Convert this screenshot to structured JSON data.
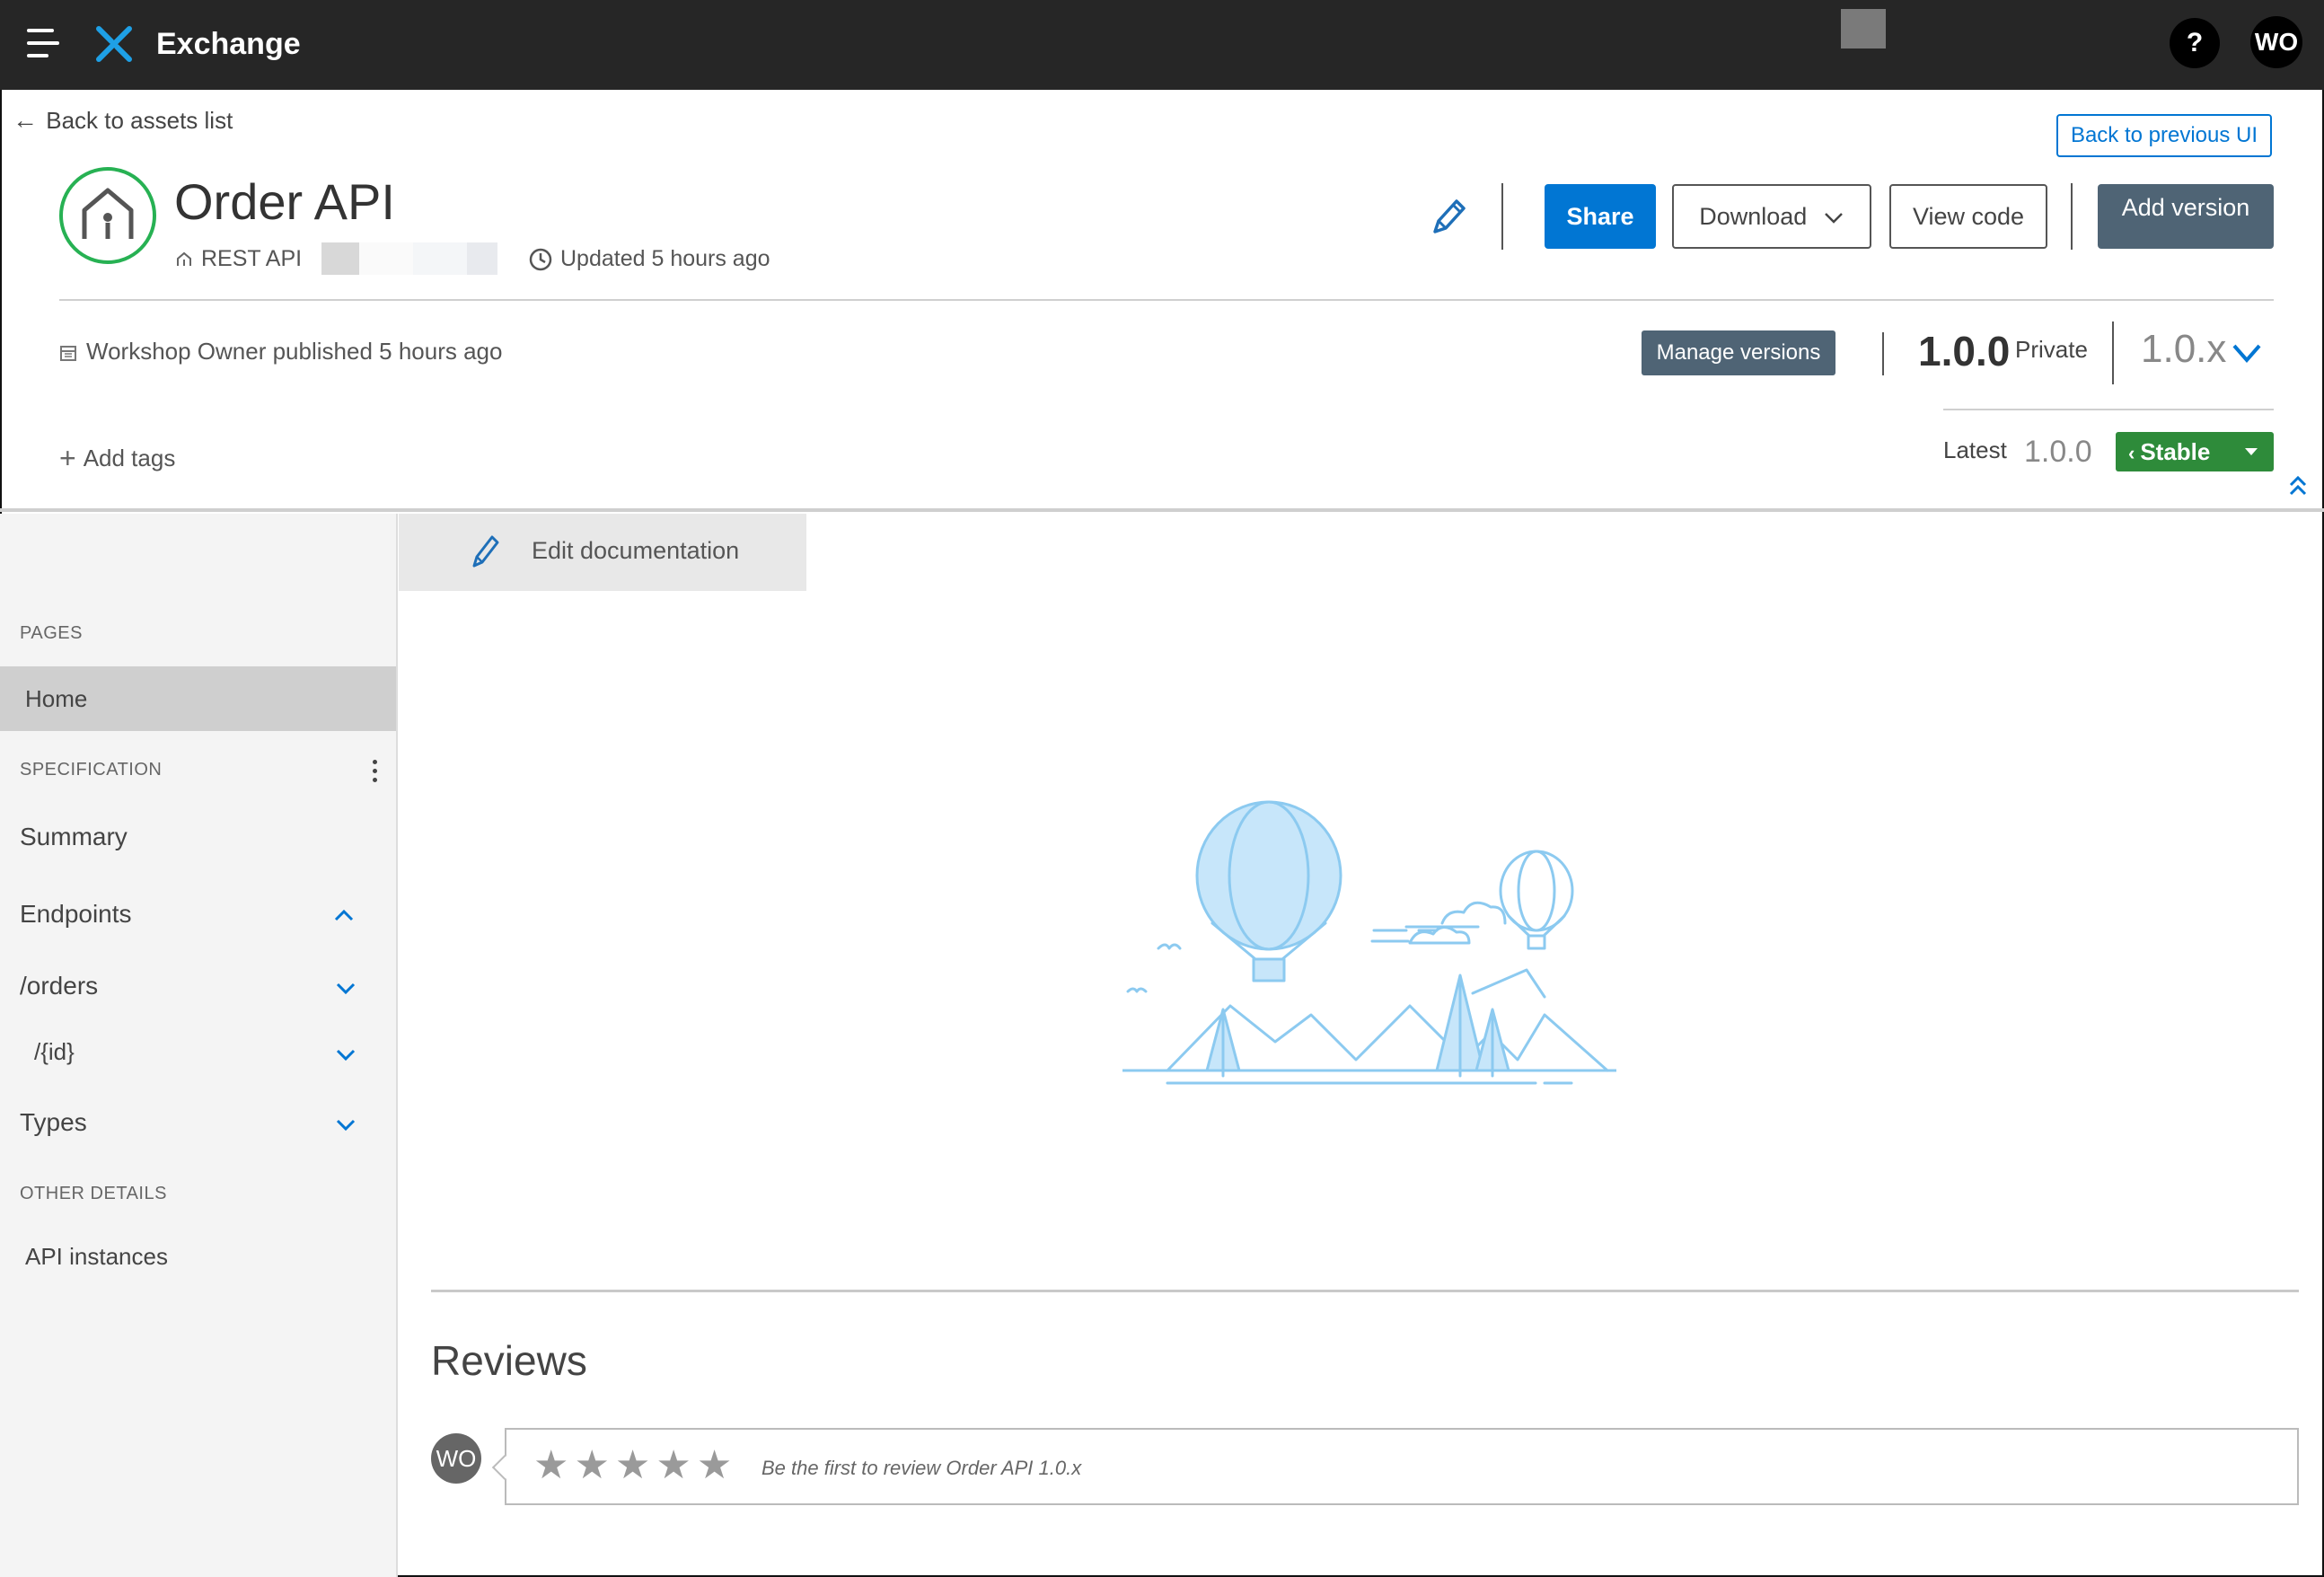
{
  "app": {
    "brand": "Exchange",
    "help_label": "?",
    "user_initials": "WO"
  },
  "header": {
    "back_label": "Back to assets list",
    "back_previous_ui": "Back to previous UI",
    "asset_title": "Order API",
    "asset_type": "REST API",
    "updated": "Updated 5 hours ago",
    "share": "Share",
    "download": "Download",
    "view_code": "View code",
    "add_version": "Add version",
    "published": "Workshop Owner published 5 hours ago",
    "manage_versions": "Manage versions",
    "version": "1.0.0",
    "visibility": "Private",
    "version_select": "1.0.x",
    "add_tags": "Add tags",
    "latest_label": "Latest",
    "latest_version": "1.0.0",
    "stability": "Stable"
  },
  "sidebar": {
    "pages_section": "PAGES",
    "home": "Home",
    "spec_section": "SPECIFICATION",
    "summary": "Summary",
    "endpoints": "Endpoints",
    "orders": "/orders",
    "id": "/{id}",
    "types": "Types",
    "other_section": "OTHER DETAILS",
    "api_instances": "API instances"
  },
  "main": {
    "edit_documentation": "Edit documentation",
    "reviews_title": "Reviews",
    "reviewer_initials": "WO",
    "review_prompt": "Be the first to review Order API 1.0.x",
    "rating_max": 5
  },
  "colors": {
    "accent": "#0176d3",
    "topbar": "#262626",
    "stable": "#2e8b3a",
    "slate": "#4f6475",
    "asset_ring": "#27b153"
  }
}
